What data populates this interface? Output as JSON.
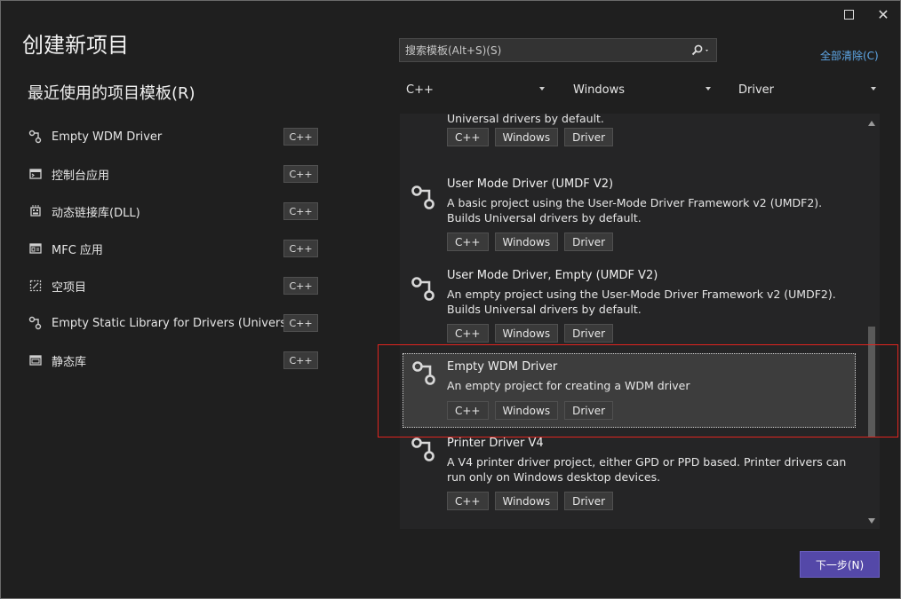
{
  "window": {
    "title": "创建新项目"
  },
  "recent": {
    "title": "最近使用的项目模板(R)",
    "items": [
      {
        "label": "Empty WDM Driver",
        "tag": "C++",
        "icon": "driver-node-icon"
      },
      {
        "label": "控制台应用",
        "tag": "C++",
        "icon": "console-app-icon"
      },
      {
        "label": "动态链接库(DLL)",
        "tag": "C++",
        "icon": "dll-icon"
      },
      {
        "label": "MFC 应用",
        "tag": "C++",
        "icon": "mfc-app-icon"
      },
      {
        "label": "空项目",
        "tag": "C++",
        "icon": "empty-project-icon"
      },
      {
        "label": "Empty Static Library for Drivers (Universal)",
        "tag": "C++",
        "icon": "driver-node-icon"
      },
      {
        "label": "静态库",
        "tag": "C++",
        "icon": "static-library-icon"
      }
    ]
  },
  "search": {
    "placeholder": "搜索模板(Alt+S)(S)",
    "icon": "search-icon"
  },
  "clear_all": "全部清除(C)",
  "filters": {
    "language": "C++",
    "platform": "Windows",
    "project_type": "Driver"
  },
  "templates": [
    {
      "name": "",
      "desc": "Universal drivers by default.",
      "tags": [
        "C++",
        "Windows",
        "Driver"
      ]
    },
    {
      "name": "User Mode Driver (UMDF V2)",
      "desc": "A basic project using the User-Mode Driver Framework v2 (UMDF2). Builds Universal drivers by default.",
      "tags": [
        "C++",
        "Windows",
        "Driver"
      ]
    },
    {
      "name": "User Mode Driver, Empty (UMDF V2)",
      "desc": "An empty project using the User-Mode Driver Framework v2 (UMDF2). Builds Universal drivers by default.",
      "tags": [
        "C++",
        "Windows",
        "Driver"
      ]
    },
    {
      "name": "Empty WDM Driver",
      "desc": "An empty project for creating a WDM driver",
      "tags": [
        "C++",
        "Windows",
        "Driver"
      ]
    },
    {
      "name": "Printer Driver V4",
      "desc": "A V4 printer driver project, either GPD or PPD based. Printer drivers can run only on Windows desktop devices.",
      "tags": [
        "C++",
        "Windows",
        "Driver"
      ]
    }
  ],
  "next_button": "下一步(N)",
  "colors": {
    "accent": "#5448a8",
    "link": "#5fa8e8",
    "highlight": "#e0241f"
  }
}
